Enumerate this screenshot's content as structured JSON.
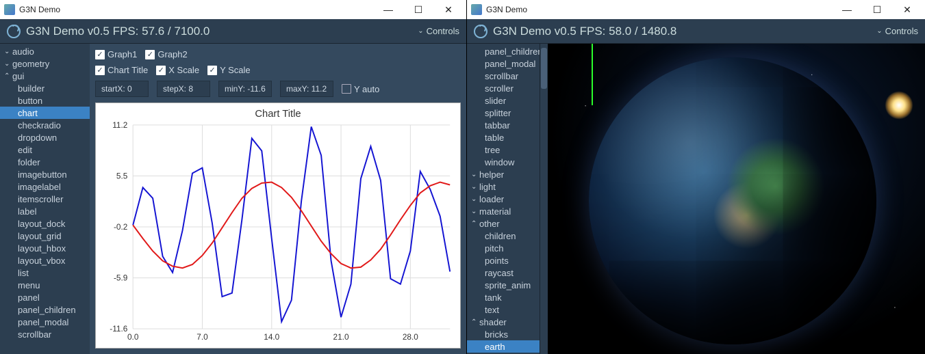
{
  "windows": [
    {
      "title": "G3N Demo",
      "header": "G3N Demo v0.5  FPS: 57.6 / 7100.0",
      "controls_label": "Controls"
    },
    {
      "title": "G3N Demo",
      "header": "G3N Demo v0.5  FPS: 58.0 / 1480.8",
      "controls_label": "Controls"
    }
  ],
  "left_tree": {
    "top": [
      {
        "label": "audio",
        "expanded": false,
        "level": 0
      },
      {
        "label": "geometry",
        "expanded": false,
        "level": 0
      },
      {
        "label": "gui",
        "expanded": true,
        "level": 0
      }
    ],
    "gui_children": [
      "builder",
      "button",
      "chart",
      "checkradio",
      "dropdown",
      "edit",
      "folder",
      "imagebutton",
      "imagelabel",
      "itemscroller",
      "label",
      "layout_dock",
      "layout_grid",
      "layout_hbox",
      "layout_vbox",
      "list",
      "menu",
      "panel",
      "panel_children",
      "panel_modal",
      "scrollbar"
    ],
    "selected": "chart"
  },
  "right_tree": {
    "items": [
      {
        "label": "panel_children",
        "level": 1
      },
      {
        "label": "panel_modal",
        "level": 1
      },
      {
        "label": "scrollbar",
        "level": 1
      },
      {
        "label": "scroller",
        "level": 1
      },
      {
        "label": "slider",
        "level": 1
      },
      {
        "label": "splitter",
        "level": 1
      },
      {
        "label": "tabbar",
        "level": 1
      },
      {
        "label": "table",
        "level": 1
      },
      {
        "label": "tree",
        "level": 1
      },
      {
        "label": "window",
        "level": 1
      },
      {
        "label": "helper",
        "level": 0,
        "expanded": false
      },
      {
        "label": "light",
        "level": 0,
        "expanded": false
      },
      {
        "label": "loader",
        "level": 0,
        "expanded": false
      },
      {
        "label": "material",
        "level": 0,
        "expanded": false
      },
      {
        "label": "other",
        "level": 0,
        "expanded": true
      },
      {
        "label": "children",
        "level": 1
      },
      {
        "label": "pitch",
        "level": 1
      },
      {
        "label": "points",
        "level": 1
      },
      {
        "label": "raycast",
        "level": 1
      },
      {
        "label": "sprite_anim",
        "level": 1
      },
      {
        "label": "tank",
        "level": 1
      },
      {
        "label": "text",
        "level": 1
      },
      {
        "label": "shader",
        "level": 0,
        "expanded": true
      },
      {
        "label": "bricks",
        "level": 1
      },
      {
        "label": "earth",
        "level": 1,
        "selected": true
      }
    ]
  },
  "chart_controls": {
    "row1": [
      {
        "label": "Graph1",
        "checked": true
      },
      {
        "label": "Graph2",
        "checked": true
      }
    ],
    "row2": [
      {
        "label": "Chart Title",
        "checked": true
      },
      {
        "label": "X Scale",
        "checked": true
      },
      {
        "label": "Y Scale",
        "checked": true
      }
    ],
    "row3_inputs": [
      {
        "label": "startX:",
        "value": "0"
      },
      {
        "label": "stepX:",
        "value": "8"
      },
      {
        "label": "minY:",
        "value": "-11.6"
      },
      {
        "label": "maxY:",
        "value": "11.2"
      }
    ],
    "yauto": {
      "label": "Y auto",
      "checked": false
    }
  },
  "chart_data": {
    "type": "line",
    "title": "Chart Title",
    "xlabel": "",
    "ylabel": "",
    "xlim": [
      0,
      32
    ],
    "ylim": [
      -11.6,
      11.2
    ],
    "xticks": [
      0.0,
      7.0,
      14.0,
      21.0,
      28.0
    ],
    "yticks": [
      -11.6,
      -5.9,
      -0.2,
      5.5,
      11.2
    ],
    "x": [
      0,
      1,
      2,
      3,
      4,
      5,
      6,
      7,
      8,
      9,
      10,
      11,
      12,
      13,
      14,
      15,
      16,
      17,
      18,
      19,
      20,
      21,
      22,
      23,
      24,
      25,
      26,
      27,
      28,
      29,
      30,
      31,
      32
    ],
    "series": [
      {
        "name": "Graph1",
        "color": "#1414d2",
        "values": [
          0.0,
          4.2,
          3.0,
          -3.5,
          -5.3,
          -0.6,
          5.8,
          6.4,
          0.2,
          -8.0,
          -7.6,
          0.6,
          9.7,
          8.3,
          -1.5,
          -10.8,
          -8.4,
          2.7,
          11.0,
          7.8,
          -4.0,
          -10.3,
          -6.6,
          5.2,
          8.8,
          5.0,
          -6.0,
          -6.6,
          -2.9,
          6.0,
          4.0,
          1.0,
          -5.2
        ]
      },
      {
        "name": "Graph2",
        "color": "#e11919",
        "values": [
          0.0,
          -1.5,
          -2.9,
          -4.0,
          -4.6,
          -4.8,
          -4.4,
          -3.4,
          -2.0,
          -0.3,
          1.4,
          3.0,
          4.1,
          4.7,
          4.8,
          4.2,
          3.1,
          1.6,
          -0.1,
          -1.8,
          -3.2,
          -4.3,
          -4.8,
          -4.7,
          -3.9,
          -2.7,
          -1.1,
          0.6,
          2.2,
          3.6,
          4.4,
          4.8,
          4.5
        ]
      }
    ]
  }
}
